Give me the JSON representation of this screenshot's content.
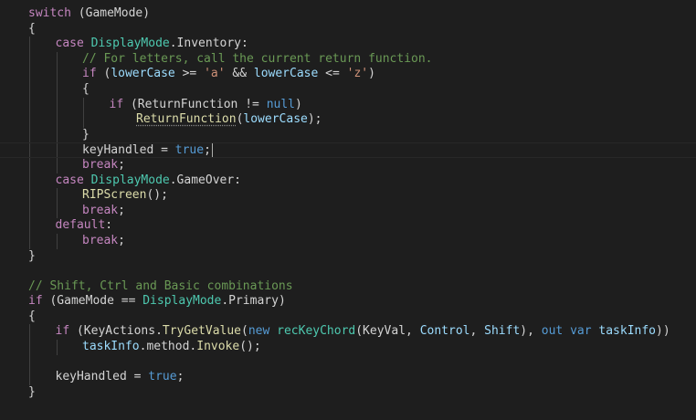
{
  "editor": {
    "lines": [
      {
        "indent": 0,
        "tokens": [
          {
            "t": "switch",
            "c": "kw"
          },
          {
            "t": " (GameMode)",
            "c": "pl"
          }
        ]
      },
      {
        "indent": 0,
        "tokens": [
          {
            "t": "{",
            "c": "pl"
          }
        ]
      },
      {
        "indent": 1,
        "tokens": [
          {
            "t": "case ",
            "c": "kw"
          },
          {
            "t": "DisplayMode",
            "c": "type"
          },
          {
            "t": ".Inventory:",
            "c": "pl"
          }
        ]
      },
      {
        "indent": 2,
        "tokens": [
          {
            "t": "// For letters, call the current return function.",
            "c": "com"
          }
        ]
      },
      {
        "indent": 2,
        "tokens": [
          {
            "t": "if",
            "c": "kw"
          },
          {
            "t": " (",
            "c": "pl"
          },
          {
            "t": "lowerCase",
            "c": "var"
          },
          {
            "t": " >= ",
            "c": "pl"
          },
          {
            "t": "'a'",
            "c": "str"
          },
          {
            "t": " && ",
            "c": "pl"
          },
          {
            "t": "lowerCase",
            "c": "var"
          },
          {
            "t": " <= ",
            "c": "pl"
          },
          {
            "t": "'z'",
            "c": "str"
          },
          {
            "t": ")",
            "c": "pl"
          }
        ]
      },
      {
        "indent": 2,
        "tokens": [
          {
            "t": "{",
            "c": "pl"
          }
        ]
      },
      {
        "indent": 3,
        "tokens": [
          {
            "t": "if",
            "c": "kw"
          },
          {
            "t": " (ReturnFunction != ",
            "c": "pl"
          },
          {
            "t": "null",
            "c": "kw2"
          },
          {
            "t": ")",
            "c": "pl"
          }
        ]
      },
      {
        "indent": 4,
        "tokens": [
          {
            "t": "ReturnFunction",
            "c": "fn",
            "squiggle": true
          },
          {
            "t": "(",
            "c": "pl"
          },
          {
            "t": "lowerCase",
            "c": "var"
          },
          {
            "t": ");",
            "c": "pl"
          }
        ]
      },
      {
        "indent": 2,
        "tokens": [
          {
            "t": "}",
            "c": "pl"
          }
        ]
      },
      {
        "indent": 2,
        "current": true,
        "tokens": [
          {
            "t": "keyHandled = ",
            "c": "pl"
          },
          {
            "t": "true",
            "c": "kw2"
          },
          {
            "t": ";",
            "c": "pl"
          }
        ]
      },
      {
        "indent": 2,
        "tokens": [
          {
            "t": "break",
            "c": "kw"
          },
          {
            "t": ";",
            "c": "pl"
          }
        ]
      },
      {
        "indent": 1,
        "tokens": [
          {
            "t": "case ",
            "c": "kw"
          },
          {
            "t": "DisplayMode",
            "c": "type"
          },
          {
            "t": ".GameOver:",
            "c": "pl"
          }
        ]
      },
      {
        "indent": 2,
        "tokens": [
          {
            "t": "RIPScreen",
            "c": "fn"
          },
          {
            "t": "();",
            "c": "pl"
          }
        ]
      },
      {
        "indent": 2,
        "tokens": [
          {
            "t": "break",
            "c": "kw"
          },
          {
            "t": ";",
            "c": "pl"
          }
        ]
      },
      {
        "indent": 1,
        "tokens": [
          {
            "t": "default",
            "c": "kw"
          },
          {
            "t": ":",
            "c": "pl"
          }
        ]
      },
      {
        "indent": 2,
        "tokens": [
          {
            "t": "break",
            "c": "kw"
          },
          {
            "t": ";",
            "c": "pl"
          }
        ]
      },
      {
        "indent": 0,
        "tokens": [
          {
            "t": "}",
            "c": "pl"
          }
        ]
      },
      {
        "indent": 0,
        "tokens": []
      },
      {
        "indent": 0,
        "tokens": [
          {
            "t": "// Shift, Ctrl and Basic combinations",
            "c": "com"
          }
        ]
      },
      {
        "indent": 0,
        "tokens": [
          {
            "t": "if",
            "c": "kw"
          },
          {
            "t": " (GameMode == ",
            "c": "pl"
          },
          {
            "t": "DisplayMode",
            "c": "type"
          },
          {
            "t": ".Primary)",
            "c": "pl"
          }
        ]
      },
      {
        "indent": 0,
        "tokens": [
          {
            "t": "{",
            "c": "pl"
          }
        ]
      },
      {
        "indent": 1,
        "tokens": [
          {
            "t": "if",
            "c": "kw"
          },
          {
            "t": " (KeyActions.",
            "c": "pl"
          },
          {
            "t": "TryGetValue",
            "c": "fn"
          },
          {
            "t": "(",
            "c": "pl"
          },
          {
            "t": "new",
            "c": "kw2"
          },
          {
            "t": " ",
            "c": "pl"
          },
          {
            "t": "recKeyChord",
            "c": "type"
          },
          {
            "t": "(KeyVal, ",
            "c": "pl"
          },
          {
            "t": "Control",
            "c": "var"
          },
          {
            "t": ", ",
            "c": "pl"
          },
          {
            "t": "Shift",
            "c": "var"
          },
          {
            "t": "), ",
            "c": "pl"
          },
          {
            "t": "out",
            "c": "kw2"
          },
          {
            "t": " ",
            "c": "pl"
          },
          {
            "t": "var",
            "c": "kw2"
          },
          {
            "t": " ",
            "c": "pl"
          },
          {
            "t": "taskInfo",
            "c": "var"
          },
          {
            "t": "))",
            "c": "pl"
          }
        ]
      },
      {
        "indent": 2,
        "tokens": [
          {
            "t": "taskInfo",
            "c": "var"
          },
          {
            "t": ".method.",
            "c": "pl"
          },
          {
            "t": "Invoke",
            "c": "fn"
          },
          {
            "t": "();",
            "c": "pl"
          }
        ]
      },
      {
        "indent": 0,
        "tokens": []
      },
      {
        "indent": 1,
        "tokens": [
          {
            "t": "keyHandled = ",
            "c": "pl"
          },
          {
            "t": "true",
            "c": "kw2"
          },
          {
            "t": ";",
            "c": "pl"
          }
        ]
      },
      {
        "indent": 0,
        "tokens": [
          {
            "t": "}",
            "c": "pl"
          }
        ]
      }
    ],
    "guides": [
      {
        "level": 1,
        "from": 2,
        "to": 15
      },
      {
        "level": 2,
        "from": 3,
        "to": 10
      },
      {
        "level": 3,
        "from": 6,
        "to": 7
      },
      {
        "level": 2,
        "from": 12,
        "to": 13
      },
      {
        "level": 2,
        "from": 15,
        "to": 15
      },
      {
        "level": 1,
        "from": 21,
        "to": 24
      },
      {
        "level": 2,
        "from": 22,
        "to": 22
      }
    ],
    "colors": {
      "background": "#1e1e1e",
      "keyword_control": "#c586c0",
      "keyword": "#569cd6",
      "type": "#4ec9b0",
      "variable": "#9cdcfe",
      "function": "#dcdcaa",
      "string": "#ce9178",
      "comment": "#6a9955",
      "plain": "#d4d4d4"
    }
  }
}
